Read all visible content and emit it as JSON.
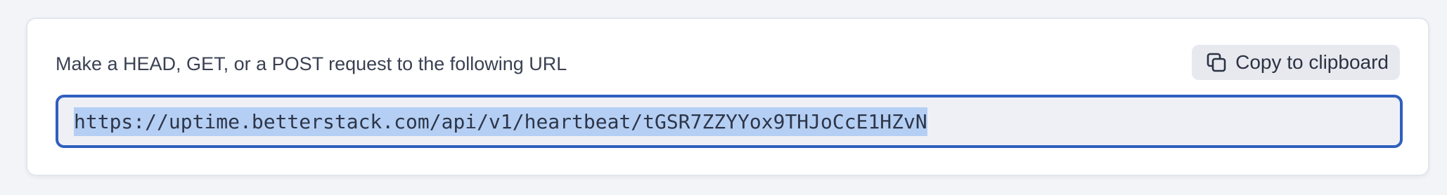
{
  "heartbeat": {
    "instruction": "Make a HEAD, GET, or a POST request to the following URL",
    "copy_button_label": "Copy to clipboard",
    "copy_icon": "copy-icon",
    "url": "https://uptime.betterstack.com/api/v1/heartbeat/tGSR7ZZYYox9THJoCcE1HZvN"
  },
  "colors": {
    "accent_border": "#2f5fbf",
    "selection": "#b5cff4",
    "page_background": "#f3f4f8"
  }
}
